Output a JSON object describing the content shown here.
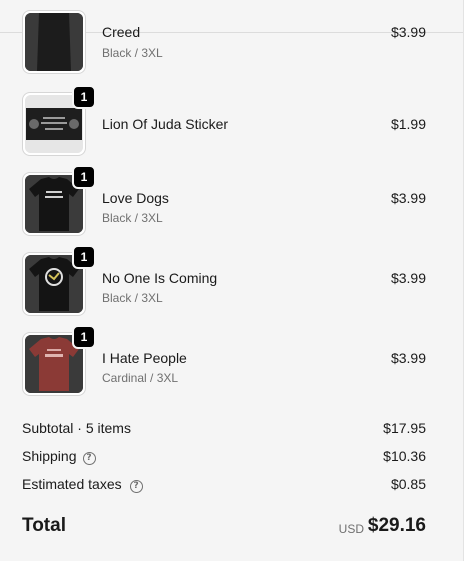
{
  "items": [
    {
      "title": "Creed",
      "variant": "Black / 3XL",
      "price": "$3.99",
      "image": "black-tshirt-creed"
    },
    {
      "title": "Lion Of Juda Sticker",
      "variant": "",
      "price": "$1.99",
      "quantity": "1",
      "image": "lion-sticker"
    },
    {
      "title": "Love Dogs",
      "variant": "Black / 3XL",
      "price": "$3.99",
      "quantity": "1",
      "image": "black-tshirt-love-dogs"
    },
    {
      "title": "No One Is Coming",
      "variant": "Black / 3XL",
      "price": "$3.99",
      "quantity": "1",
      "image": "black-tshirt-no-one-is-coming"
    },
    {
      "title": "I Hate People",
      "variant": "Cardinal / 3XL",
      "price": "$3.99",
      "quantity": "1",
      "image": "cardinal-tshirt-i-hate-people"
    }
  ],
  "summary": {
    "subtotal_label": "Subtotal · 5 items",
    "subtotal_value": "$17.95",
    "shipping_label": "Shipping",
    "shipping_value": "$10.36",
    "taxes_label": "Estimated taxes",
    "taxes_value": "$0.85",
    "help_icon": "?"
  },
  "total": {
    "label": "Total",
    "currency": "USD",
    "value": "$29.16"
  },
  "colors": {
    "background": "#f5f5f5",
    "badge": "#000000",
    "muted_text": "#707070",
    "cardinal_shirt": "#8b3a36"
  }
}
